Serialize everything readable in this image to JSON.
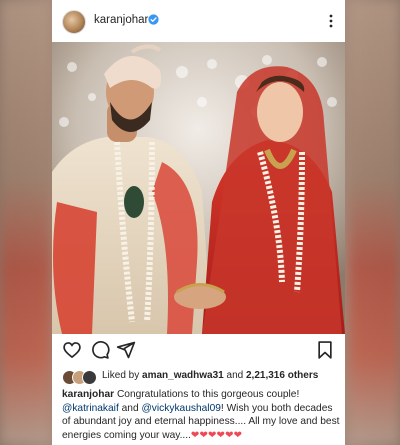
{
  "post": {
    "username": "karanjohar",
    "liked": {
      "prefix": "Liked by",
      "user": "aman_wadhwa31",
      "and": "and",
      "count": "2,21,316 others"
    },
    "caption": {
      "author": "karanjohar",
      "line1": "Congratulations to this gorgeous couple!",
      "mention1": "@katrinakaif",
      "and": "and",
      "mention2": "@vickykaushal09",
      "rest": "! Wish you both decades of abundant joy and eternal happiness.... All my love and best energies coming your way....",
      "hearts": "❤❤❤❤❤❤"
    }
  },
  "colors": {
    "verified": "#3897f0",
    "mention": "#00376b",
    "heart": "#ed4956",
    "text": "#262626"
  },
  "icons": {
    "actions": [
      "heart-icon",
      "comment-icon",
      "share-icon",
      "bookmark-icon"
    ],
    "header": [
      "verified-badge-icon",
      "more-options-icon"
    ]
  }
}
